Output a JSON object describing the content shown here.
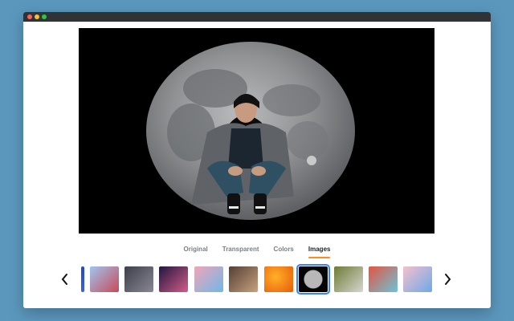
{
  "window": {
    "controls": [
      "close",
      "minimize",
      "maximize"
    ]
  },
  "preview": {
    "background": "#000000",
    "moon_color": "#8d8f91",
    "subject_jacket_color": "#5f6266",
    "subject_jeans_color": "#2f4f63"
  },
  "tabs": [
    {
      "label": "Original",
      "active": false
    },
    {
      "label": "Transparent",
      "active": false
    },
    {
      "label": "Colors",
      "active": false
    },
    {
      "label": "Images",
      "active": true
    }
  ],
  "accent_color": "#ff8a1f",
  "selected_outline_color": "#3b82f6",
  "thumbnails": {
    "prev_icon": "chevron-left-icon",
    "next_icon": "chevron-right-icon",
    "items": [
      {
        "name": "thumb-blue-edge",
        "colors": [
          "#1f47c8",
          "#4062e0"
        ]
      },
      {
        "name": "thumb-blue-paint",
        "colors": [
          "#9fc5ef",
          "#c94a5a"
        ]
      },
      {
        "name": "thumb-night-sky",
        "colors": [
          "#3d3f4c",
          "#8a8794"
        ]
      },
      {
        "name": "thumb-sunset-water",
        "colors": [
          "#20183f",
          "#d35a8a"
        ]
      },
      {
        "name": "thumb-pink-sky",
        "colors": [
          "#f0a6b7",
          "#6fb8e8"
        ]
      },
      {
        "name": "thumb-city-street",
        "colors": [
          "#553f35",
          "#c7a27e"
        ]
      },
      {
        "name": "thumb-fire",
        "colors": [
          "#e85b07",
          "#ffb02a"
        ]
      },
      {
        "name": "thumb-moon",
        "colors": [
          "#050505",
          "#b8b8b8"
        ],
        "selected": true
      },
      {
        "name": "thumb-waterfall",
        "colors": [
          "#6d7c34",
          "#d7d6d0"
        ]
      },
      {
        "name": "thumb-red-abstract",
        "colors": [
          "#e4553f",
          "#6cc3d6"
        ]
      },
      {
        "name": "thumb-pink-abstract",
        "colors": [
          "#f4c1cb",
          "#6fa8e8"
        ]
      }
    ]
  }
}
